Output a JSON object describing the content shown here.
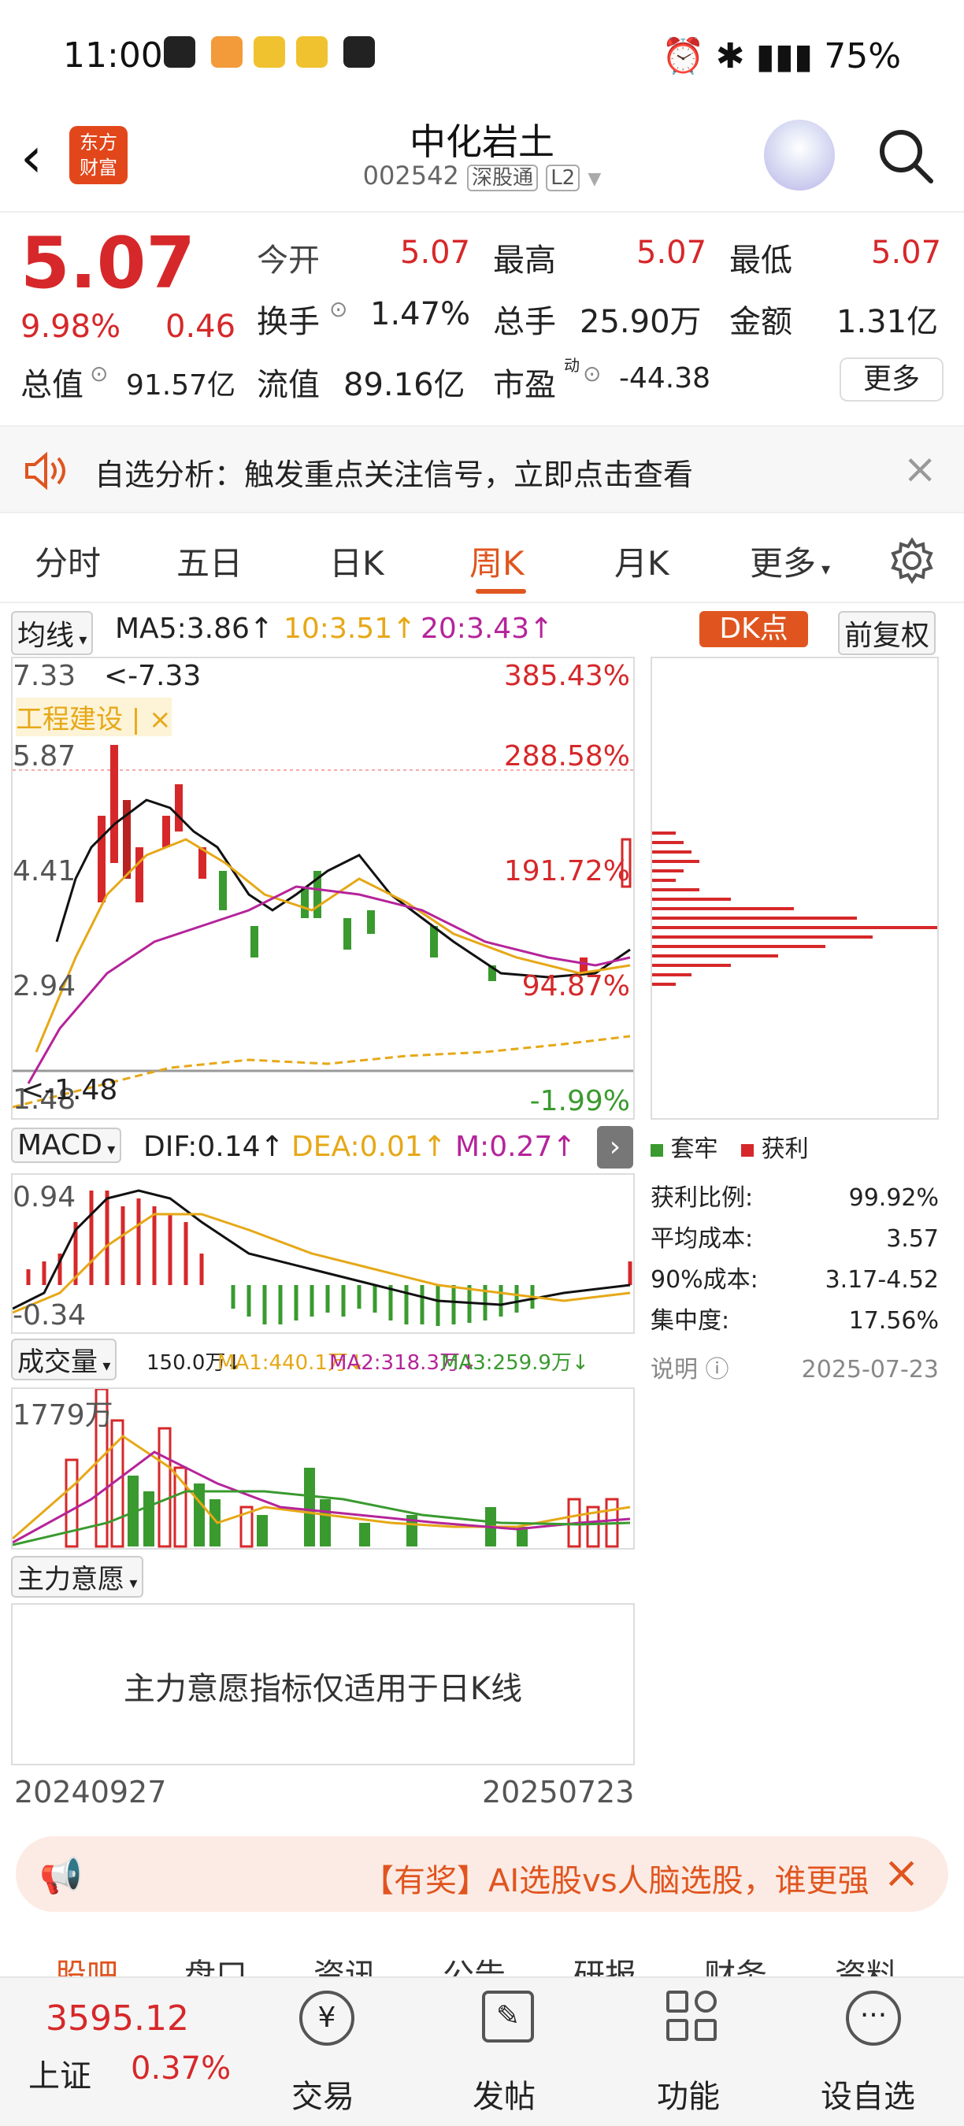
{
  "status": {
    "time": "11:00",
    "battery": "75%"
  },
  "header": {
    "title": "中化岩土",
    "code": "002542",
    "market": "深股通",
    "level": "L2",
    "logo_text": "东方财富"
  },
  "quote": {
    "price": "5.07",
    "change_pct": "9.98%",
    "change": "0.46",
    "open_label": "今开",
    "open": "5.07",
    "high_label": "最高",
    "high": "5.07",
    "low_label": "最低",
    "low": "5.07",
    "turnover_label": "换手",
    "turnover": "1.47%",
    "vol_label": "总手",
    "vol": "25.90万",
    "amount_label": "金额",
    "amount": "1.31亿",
    "mcap_label": "总值",
    "mcap": "91.57亿",
    "float_label": "流值",
    "float": "89.16亿",
    "pe_label": "市盈",
    "pe_sup": "动",
    "pe": "-44.38",
    "more": "更多"
  },
  "notice": {
    "text": "自选分析：触发重点关注信号，立即点击查看"
  },
  "tabs": [
    "分时",
    "五日",
    "日K",
    "周K",
    "月K",
    "更多"
  ],
  "ma": {
    "selector": "均线",
    "ma5": "MA5:3.86↑",
    "ma10": "10:3.51↑",
    "ma20": "20:3.43↑",
    "dk": "DK点",
    "adjust": "前复权"
  },
  "kchart": {
    "y1": "7.33",
    "y2": "5.87",
    "y3": "4.41",
    "y4": "2.94",
    "y5": "1.48",
    "pct1": "385.43%",
    "pct2": "288.58%",
    "pct3": "191.72%",
    "pct4": "94.87%",
    "pct5": "-1.99%",
    "hi_note": "<-7.33",
    "lo_note": "<-1.48",
    "sector": "工程建设 | ×"
  },
  "macd": {
    "selector": "MACD",
    "dif": "DIF:0.14↑",
    "dea": "DEA:0.01↑",
    "m": "M:0.27↑",
    "top": "0.94",
    "bottom": "-0.34"
  },
  "chips": {
    "legend_trap": "套牢",
    "legend_profit": "获利",
    "profit_label": "获利比例:",
    "profit": "99.92%",
    "avg_label": "平均成本:",
    "avg": "3.57",
    "c90_label": "90%成本:",
    "c90": "3.17-4.52",
    "conc_label": "集中度:",
    "conc": "17.56%",
    "explain": "说明",
    "date": "2025-07-23"
  },
  "volume": {
    "selector": "成交量",
    "v": "150.0万↓",
    "ma1": "MA1:440.1万↓",
    "ma2": "MA2:318.3万↓",
    "ma3": "MA3:259.9万↓",
    "top": "1779万"
  },
  "intent": {
    "selector": "主力意愿",
    "msg": "主力意愿指标仅适用于日K线"
  },
  "dates": {
    "start": "20240927",
    "end": "20250723"
  },
  "ad": {
    "text": "【有奖】AI选股vs人脑选股，谁更强"
  },
  "bottom_tabs": [
    "股吧",
    "盘口",
    "资讯",
    "公告",
    "研报",
    "财务",
    "资料"
  ],
  "footer": {
    "index": "3595.12",
    "index_name": "上证",
    "index_pct": "0.37%",
    "trade": "交易",
    "post": "发帖",
    "func": "功能",
    "watch": "设自选"
  },
  "colors": {
    "up": "#d6282a",
    "down": "#3a9a2f",
    "accent": "#e0551f"
  }
}
